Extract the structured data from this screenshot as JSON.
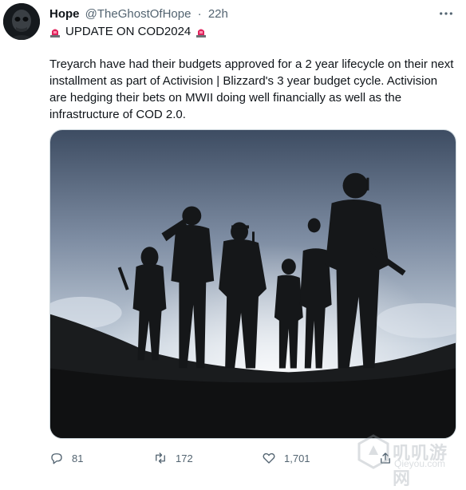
{
  "tweet": {
    "author_name": "Hope",
    "author_handle": "@TheGhostOfHope",
    "separator": "·",
    "timestamp": "22h",
    "headline": "UPDATE ON COD2024",
    "headline_icon": "police-siren-emoji",
    "body": "Treyarch have had their budgets approved for a 2 year lifecycle on their next installment as part of Activision | Blizzard's 3 year budget cycle. Activision are hedging their bets on MWII doing well financially as well as the infrastructure of COD 2.0.",
    "more_icon": "more-options-icon"
  },
  "actions": {
    "reply_count": "81",
    "retweet_count": "172",
    "like_count": "1,701"
  },
  "watermark": {
    "text": "叽叽游网",
    "sub": "Qieyou.com"
  },
  "colors": {
    "text": "#0f1419",
    "secondary": "#536471",
    "siren_red": "#e0245e"
  }
}
